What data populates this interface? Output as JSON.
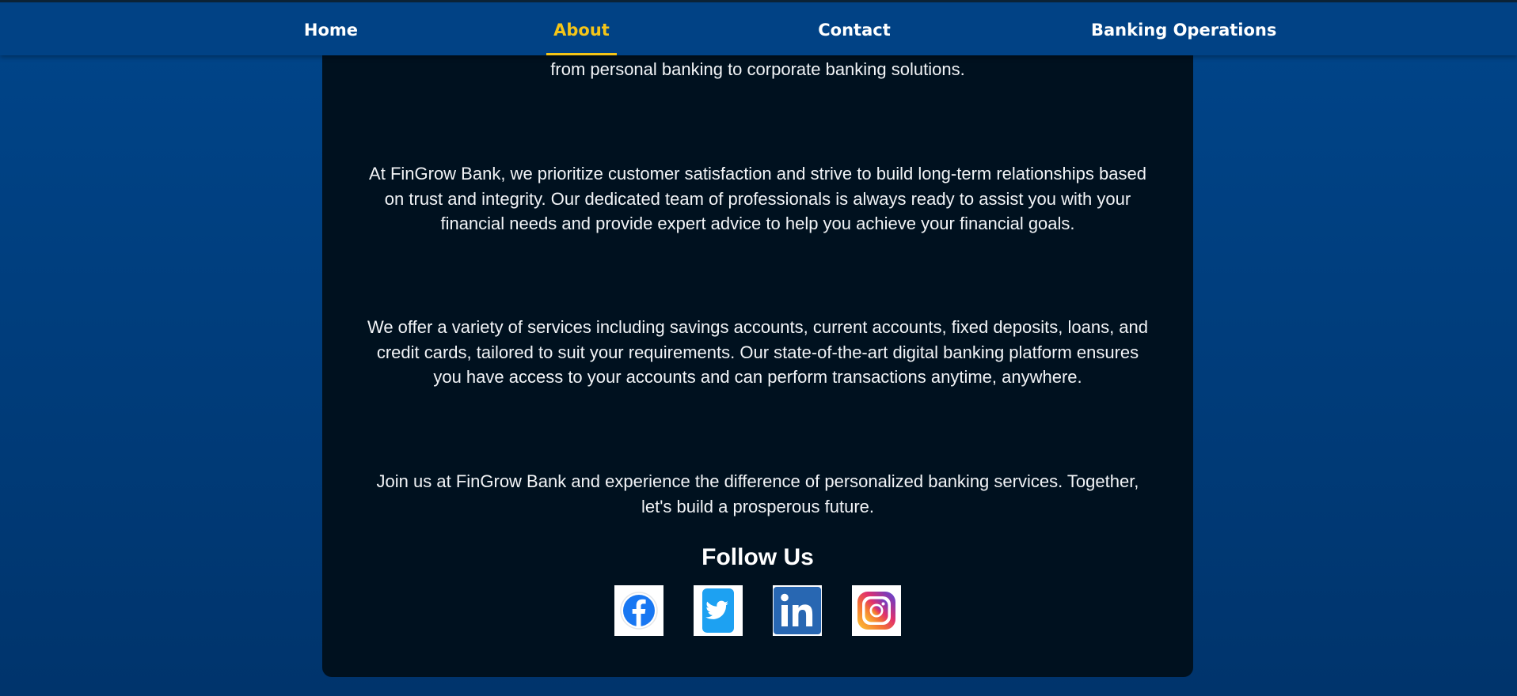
{
  "nav": {
    "items": [
      {
        "label": "Home",
        "active": false
      },
      {
        "label": "About",
        "active": true
      },
      {
        "label": "Contact",
        "active": false
      },
      {
        "label": "Banking Operations",
        "active": false
      }
    ],
    "active_color": "#f5c518"
  },
  "about": {
    "paragraphs": [
      "from personal banking to corporate banking solutions.",
      "At FinGrow Bank, we prioritize customer satisfaction and strive to build long-term relationships based on trust and integrity. Our dedicated team of professionals is always ready to assist you with your financial needs and provide expert advice to help you achieve your financial goals.",
      "We offer a variety of services including savings accounts, current accounts, fixed deposits, loans, and credit cards, tailored to suit your requirements. Our state-of-the-art digital banking platform ensures you have access to your accounts and can perform transactions anytime, anywhere.",
      "Join us at FinGrow Bank and experience the difference of personalized banking services. Together, let's build a prosperous future."
    ]
  },
  "follow": {
    "title": "Follow Us",
    "links": [
      {
        "name": "facebook",
        "icon": "facebook-icon",
        "color": "#1877f2"
      },
      {
        "name": "twitter",
        "icon": "twitter-icon",
        "color": "#1da1f2"
      },
      {
        "name": "linkedin",
        "icon": "linkedin-icon",
        "color": "#2867b2"
      },
      {
        "name": "instagram",
        "icon": "instagram-icon",
        "color": "#e1306c"
      }
    ]
  }
}
